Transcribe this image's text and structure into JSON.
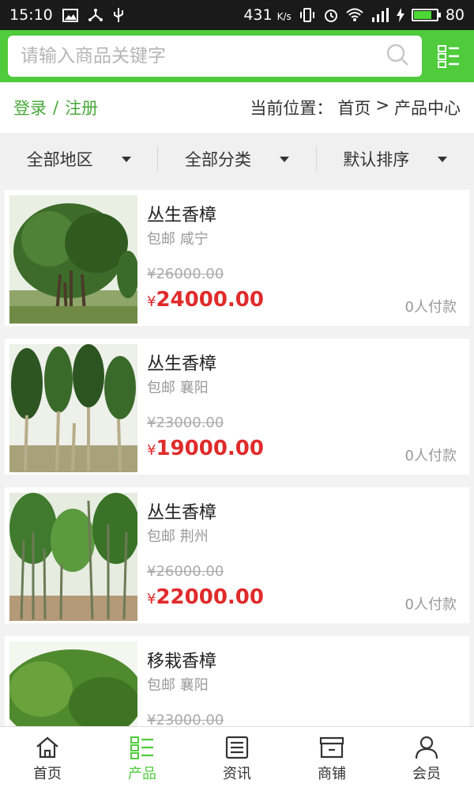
{
  "status_bar": {
    "time": "15:10",
    "speed": "431",
    "speed_unit": "K/s",
    "battery": "80",
    "battery_level": 0.8
  },
  "search": {
    "placeholder": "请输入商品关键字"
  },
  "location": {
    "login": "登录",
    "separator": "/",
    "register": "注册",
    "breadcrumb_label": "当前位置：",
    "home": "首页",
    "arrow": ">",
    "current": "产品中心"
  },
  "filters": [
    {
      "label": "全部地区"
    },
    {
      "label": "全部分类"
    },
    {
      "label": "默认排序"
    }
  ],
  "products": [
    {
      "title": "丛生香樟",
      "ship": "包邮 咸宁",
      "old_price": "¥26000.00",
      "yen": "¥",
      "price": "24000.00",
      "sold": "0人付款"
    },
    {
      "title": "丛生香樟",
      "ship": "包邮 襄阳",
      "old_price": "¥23000.00",
      "yen": "¥",
      "price": "19000.00",
      "sold": "0人付款"
    },
    {
      "title": "丛生香樟",
      "ship": "包邮 荆州",
      "old_price": "¥26000.00",
      "yen": "¥",
      "price": "22000.00",
      "sold": "0人付款"
    },
    {
      "title": "移栽香樟",
      "ship": "包邮 襄阳",
      "old_price": "¥23000.00",
      "yen": "¥",
      "price": "",
      "sold": ""
    }
  ],
  "nav": [
    {
      "label": "首页",
      "icon": "home-icon"
    },
    {
      "label": "产品",
      "icon": "products-icon",
      "active": true
    },
    {
      "label": "资讯",
      "icon": "news-icon"
    },
    {
      "label": "商铺",
      "icon": "store-icon"
    },
    {
      "label": "会员",
      "icon": "user-icon"
    }
  ],
  "colors": {
    "brand_green": "#4fcb3c",
    "link_green": "#4aa83c",
    "price_red": "#e02b2b"
  }
}
